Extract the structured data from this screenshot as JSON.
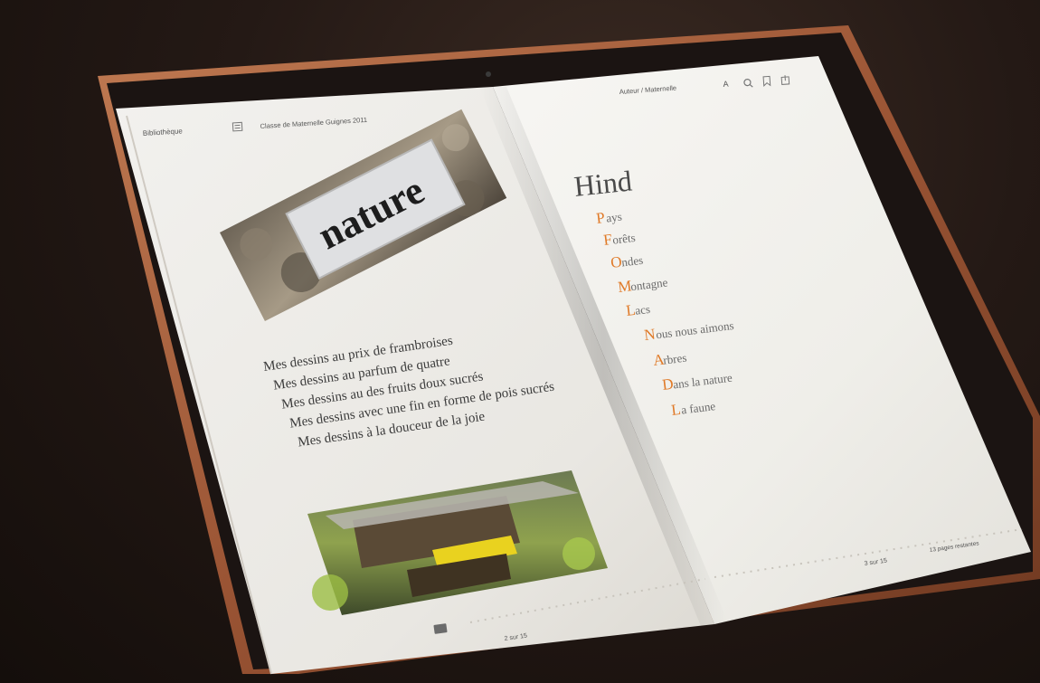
{
  "toolbar": {
    "library_label": "Bibliothèque",
    "book_title": "Classe de Maternelle Guignes 2011",
    "right_label": "Auteur / Maternelle"
  },
  "left_page": {
    "photo_sign_text": "nature",
    "poem_lines": [
      "Mes dessins au prix de frambroises",
      "Mes dessins au parfum de quatre",
      "Mes dessins au des fruits doux sucrés",
      "Mes dessins avec une fin en forme de pois sucrés",
      "Mes dessins à la douceur de la joie"
    ],
    "page_number": "2 sur 15"
  },
  "right_page": {
    "heading": "Hind",
    "toc": [
      {
        "initial": "P",
        "rest": "ays"
      },
      {
        "initial": "F",
        "rest": "orêts"
      },
      {
        "initial": "O",
        "rest": "ndes"
      },
      {
        "initial": "M",
        "rest": "ontagne"
      },
      {
        "initial": "L",
        "rest": "acs"
      },
      {
        "initial": "N",
        "rest": "ous nous aimons"
      },
      {
        "initial": "A",
        "rest": "rbres"
      },
      {
        "initial": "D",
        "rest": "ans la nature"
      },
      {
        "initial": "L",
        "rest": "a faune"
      }
    ],
    "page_number": "3 sur 15",
    "pages_left": "13 pages restantes"
  },
  "colors": {
    "accent_initial": "#e07a28",
    "page": "#f3f1ec",
    "frame": "#8a4a2a"
  }
}
